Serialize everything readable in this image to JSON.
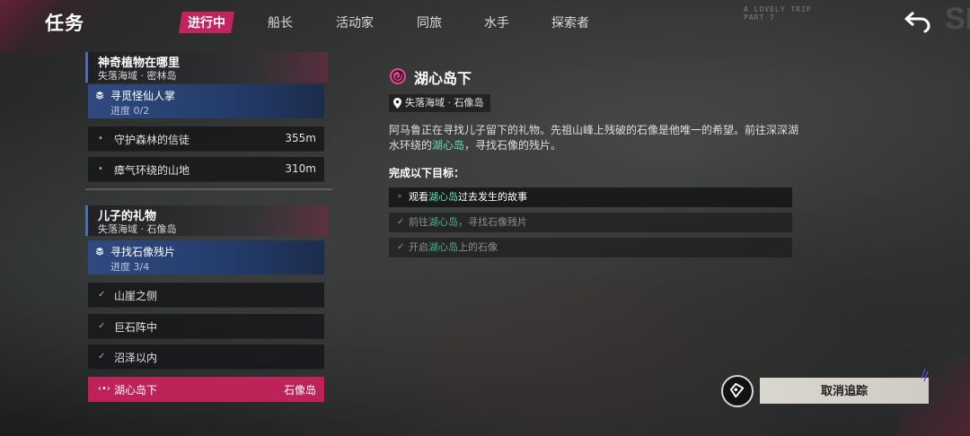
{
  "header": {
    "title": "任务",
    "tabs": [
      {
        "label": "进行中",
        "active": true
      },
      {
        "label": "船长",
        "active": false
      },
      {
        "label": "活动家",
        "active": false
      },
      {
        "label": "同旅",
        "active": false
      },
      {
        "label": "水手",
        "active": false
      },
      {
        "label": "探索者",
        "active": false
      }
    ],
    "back_icon": "back-arrow-icon"
  },
  "quest_groups": [
    {
      "title": "神奇植物在哪里",
      "location": "失落海域 · 密林岛",
      "objective": {
        "title": "寻觅怪仙人掌",
        "progress_text": "进度 0/2"
      },
      "rows": [
        {
          "label": "守护森林的信徒",
          "distance": "355m",
          "status": "pending"
        },
        {
          "label": "瘴气环绕的山地",
          "distance": "310m",
          "status": "pending"
        }
      ]
    },
    {
      "title": "儿子的礼物",
      "location": "失落海域 · 石像岛",
      "objective": {
        "title": "寻找石像残片",
        "progress_text": "进度 3/4"
      },
      "rows": [
        {
          "label": "山崖之侧",
          "status": "done"
        },
        {
          "label": "巨石阵中",
          "status": "done"
        },
        {
          "label": "沼泽以内",
          "status": "done"
        },
        {
          "label": "湖心岛下",
          "location": "石像岛",
          "status": "selected"
        }
      ]
    }
  ],
  "detail": {
    "title": "湖心岛下",
    "location": "失落海域 · 石像岛",
    "description_part1": "阿马鲁正在寻找儿子留下的礼物。先祖山峰上残破的石像是他唯一的希望。前往深深湖水环绕的",
    "description_highlight": "湖心岛",
    "description_part2": "，寻找石像的残片。",
    "goals_heading": "完成以下目标：",
    "goals": [
      {
        "pre": "观看",
        "highlight": "湖心岛",
        "post": "过去发生的故事",
        "state": "current"
      },
      {
        "pre": "前往",
        "highlight": "湖心岛",
        "post": "，寻找石像残片",
        "state": "done"
      },
      {
        "pre": "开启",
        "highlight": "湖心岛",
        "post": "上的石像",
        "state": "done"
      }
    ]
  },
  "track": {
    "cancel_label": "取消追踪",
    "icon": "track-marker-icon"
  },
  "colors": {
    "accent_pink": "#c2245f",
    "objective_blue": "#2f4a80",
    "highlight_green": "#5fe0b0"
  }
}
